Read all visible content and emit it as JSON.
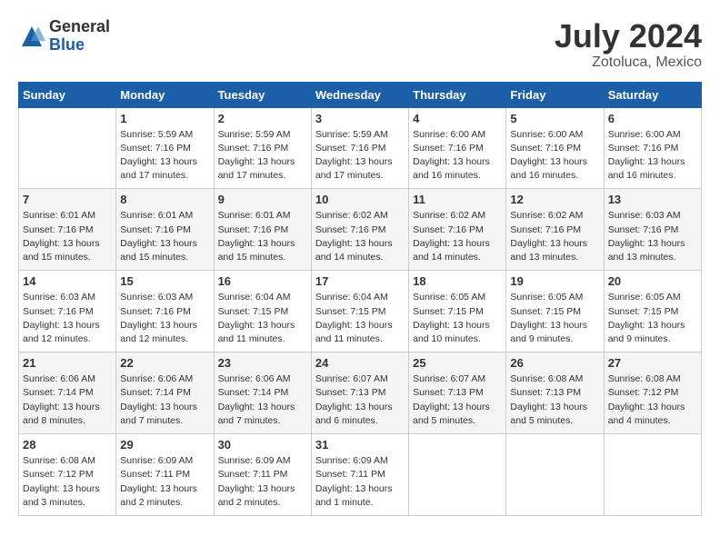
{
  "logo": {
    "general": "General",
    "blue": "Blue"
  },
  "title": {
    "month_year": "July 2024",
    "location": "Zotoluca, Mexico"
  },
  "weekdays": [
    "Sunday",
    "Monday",
    "Tuesday",
    "Wednesday",
    "Thursday",
    "Friday",
    "Saturday"
  ],
  "weeks": [
    [
      {
        "day": "",
        "info": ""
      },
      {
        "day": "1",
        "info": "Sunrise: 5:59 AM\nSunset: 7:16 PM\nDaylight: 13 hours\nand 17 minutes."
      },
      {
        "day": "2",
        "info": "Sunrise: 5:59 AM\nSunset: 7:16 PM\nDaylight: 13 hours\nand 17 minutes."
      },
      {
        "day": "3",
        "info": "Sunrise: 5:59 AM\nSunset: 7:16 PM\nDaylight: 13 hours\nand 17 minutes."
      },
      {
        "day": "4",
        "info": "Sunrise: 6:00 AM\nSunset: 7:16 PM\nDaylight: 13 hours\nand 16 minutes."
      },
      {
        "day": "5",
        "info": "Sunrise: 6:00 AM\nSunset: 7:16 PM\nDaylight: 13 hours\nand 16 minutes."
      },
      {
        "day": "6",
        "info": "Sunrise: 6:00 AM\nSunset: 7:16 PM\nDaylight: 13 hours\nand 16 minutes."
      }
    ],
    [
      {
        "day": "7",
        "info": "Sunrise: 6:01 AM\nSunset: 7:16 PM\nDaylight: 13 hours\nand 15 minutes."
      },
      {
        "day": "8",
        "info": "Sunrise: 6:01 AM\nSunset: 7:16 PM\nDaylight: 13 hours\nand 15 minutes."
      },
      {
        "day": "9",
        "info": "Sunrise: 6:01 AM\nSunset: 7:16 PM\nDaylight: 13 hours\nand 15 minutes."
      },
      {
        "day": "10",
        "info": "Sunrise: 6:02 AM\nSunset: 7:16 PM\nDaylight: 13 hours\nand 14 minutes."
      },
      {
        "day": "11",
        "info": "Sunrise: 6:02 AM\nSunset: 7:16 PM\nDaylight: 13 hours\nand 14 minutes."
      },
      {
        "day": "12",
        "info": "Sunrise: 6:02 AM\nSunset: 7:16 PM\nDaylight: 13 hours\nand 13 minutes."
      },
      {
        "day": "13",
        "info": "Sunrise: 6:03 AM\nSunset: 7:16 PM\nDaylight: 13 hours\nand 13 minutes."
      }
    ],
    [
      {
        "day": "14",
        "info": "Sunrise: 6:03 AM\nSunset: 7:16 PM\nDaylight: 13 hours\nand 12 minutes."
      },
      {
        "day": "15",
        "info": "Sunrise: 6:03 AM\nSunset: 7:16 PM\nDaylight: 13 hours\nand 12 minutes."
      },
      {
        "day": "16",
        "info": "Sunrise: 6:04 AM\nSunset: 7:15 PM\nDaylight: 13 hours\nand 11 minutes."
      },
      {
        "day": "17",
        "info": "Sunrise: 6:04 AM\nSunset: 7:15 PM\nDaylight: 13 hours\nand 11 minutes."
      },
      {
        "day": "18",
        "info": "Sunrise: 6:05 AM\nSunset: 7:15 PM\nDaylight: 13 hours\nand 10 minutes."
      },
      {
        "day": "19",
        "info": "Sunrise: 6:05 AM\nSunset: 7:15 PM\nDaylight: 13 hours\nand 9 minutes."
      },
      {
        "day": "20",
        "info": "Sunrise: 6:05 AM\nSunset: 7:15 PM\nDaylight: 13 hours\nand 9 minutes."
      }
    ],
    [
      {
        "day": "21",
        "info": "Sunrise: 6:06 AM\nSunset: 7:14 PM\nDaylight: 13 hours\nand 8 minutes."
      },
      {
        "day": "22",
        "info": "Sunrise: 6:06 AM\nSunset: 7:14 PM\nDaylight: 13 hours\nand 7 minutes."
      },
      {
        "day": "23",
        "info": "Sunrise: 6:06 AM\nSunset: 7:14 PM\nDaylight: 13 hours\nand 7 minutes."
      },
      {
        "day": "24",
        "info": "Sunrise: 6:07 AM\nSunset: 7:13 PM\nDaylight: 13 hours\nand 6 minutes."
      },
      {
        "day": "25",
        "info": "Sunrise: 6:07 AM\nSunset: 7:13 PM\nDaylight: 13 hours\nand 5 minutes."
      },
      {
        "day": "26",
        "info": "Sunrise: 6:08 AM\nSunset: 7:13 PM\nDaylight: 13 hours\nand 5 minutes."
      },
      {
        "day": "27",
        "info": "Sunrise: 6:08 AM\nSunset: 7:12 PM\nDaylight: 13 hours\nand 4 minutes."
      }
    ],
    [
      {
        "day": "28",
        "info": "Sunrise: 6:08 AM\nSunset: 7:12 PM\nDaylight: 13 hours\nand 3 minutes."
      },
      {
        "day": "29",
        "info": "Sunrise: 6:09 AM\nSunset: 7:11 PM\nDaylight: 13 hours\nand 2 minutes."
      },
      {
        "day": "30",
        "info": "Sunrise: 6:09 AM\nSunset: 7:11 PM\nDaylight: 13 hours\nand 2 minutes."
      },
      {
        "day": "31",
        "info": "Sunrise: 6:09 AM\nSunset: 7:11 PM\nDaylight: 13 hours\nand 1 minute."
      },
      {
        "day": "",
        "info": ""
      },
      {
        "day": "",
        "info": ""
      },
      {
        "day": "",
        "info": ""
      }
    ]
  ]
}
